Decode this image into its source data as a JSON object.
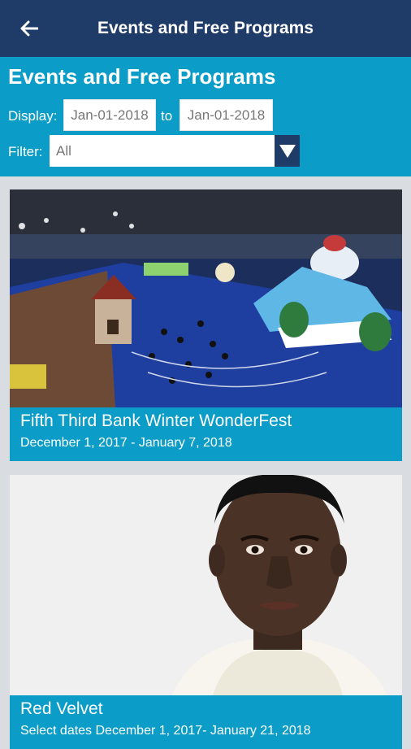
{
  "appbar": {
    "title": "Events and Free Programs",
    "back_icon": "arrow-left-icon"
  },
  "header": {
    "title": "Events and Free Programs",
    "display_label": "Display:",
    "date_from": "Jan-01-2018",
    "to_label": "to",
    "date_to": "Jan-01-2018",
    "filter_label": "Filter:",
    "filter_value": "All"
  },
  "events": [
    {
      "title": "Fifth Third Bank Winter WonderFest",
      "dates": "December 1, 2017 - January 7, 2018"
    },
    {
      "title": "Red Velvet",
      "dates": "Select dates December 1, 2017- January 21, 2018"
    }
  ],
  "colors": {
    "appbar": "#1f3b67",
    "accent": "#0b9cc7"
  }
}
